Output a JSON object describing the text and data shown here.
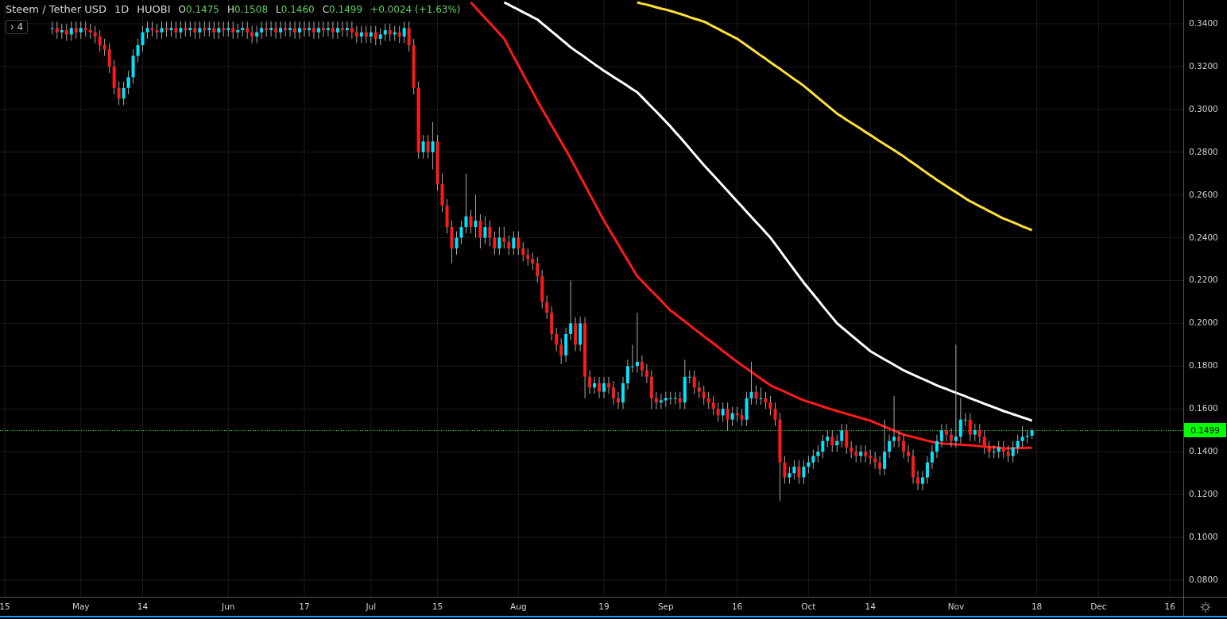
{
  "legend": {
    "interval": "1D",
    "exchange": "HUOBI",
    "ohlc": [
      {
        "label": "O",
        "value": "0.1475"
      },
      {
        "label": "H",
        "value": "0.1508"
      },
      {
        "label": "L",
        "value": "0.1460"
      },
      {
        "label": "C",
        "value": "0.1499"
      }
    ],
    "change": "+0.0024 (+1.63%)",
    "indicators_toggle": {
      "icon_text": "›",
      "count": "4"
    }
  },
  "last_price": "0.1499",
  "chart_data": {
    "type": "candlestick",
    "title": "Steem / Tether USD",
    "grid": true,
    "xlim": [
      "--04-14",
      "--12-28"
    ],
    "ylim": [
      0.0722,
      0.3511
    ],
    "ref_lines": [
      {
        "axis": "y",
        "value": 0.1499,
        "color": "#00ff00"
      }
    ],
    "yticks": [
      {
        "value": 0.08,
        "label": "0.0800"
      },
      {
        "value": 0.1,
        "label": "0.1000"
      },
      {
        "value": 0.12,
        "label": "0.1200"
      },
      {
        "value": 0.14,
        "label": "0.1400"
      },
      {
        "value": 0.16,
        "label": "0.1600"
      },
      {
        "value": 0.18,
        "label": "0.1800"
      },
      {
        "value": 0.2,
        "label": "0.2000"
      },
      {
        "value": 0.22,
        "label": "0.2200"
      },
      {
        "value": 0.24,
        "label": "0.2400"
      },
      {
        "value": 0.26,
        "label": "0.2600"
      },
      {
        "value": 0.28,
        "label": "0.2800"
      },
      {
        "value": 0.3,
        "label": "0.3000"
      },
      {
        "value": 0.32,
        "label": "0.3200"
      },
      {
        "value": 0.34,
        "label": "0.3400"
      }
    ],
    "xticks": [
      {
        "value": "--04-15",
        "label": "15"
      },
      {
        "value": "--05-01",
        "label": "May"
      },
      {
        "value": "--05-14",
        "label": "14"
      },
      {
        "value": "--06-01",
        "label": "Jun"
      },
      {
        "value": "--06-17",
        "label": "17"
      },
      {
        "value": "--07-01",
        "label": "Jul"
      },
      {
        "value": "--07-15",
        "label": "15"
      },
      {
        "value": "--08-01",
        "label": "Aug"
      },
      {
        "value": "--08-19",
        "label": "19"
      },
      {
        "value": "--09-01",
        "label": "Sep"
      },
      {
        "value": "--09-16",
        "label": "16"
      },
      {
        "value": "--10-01",
        "label": "Oct"
      },
      {
        "value": "--10-14",
        "label": "14"
      },
      {
        "value": "--11-01",
        "label": "Nov"
      },
      {
        "value": "--11-18",
        "label": "18"
      },
      {
        "value": "--12-01",
        "label": "Dec"
      },
      {
        "value": "--12-16",
        "label": "16"
      }
    ],
    "x": [
      "--04-25",
      "--04-26",
      "--04-27",
      "--04-28",
      "--04-29",
      "--04-30",
      "--05-01",
      "--05-02",
      "--05-03",
      "--05-04",
      "--05-05",
      "--05-06",
      "--05-07",
      "--05-08",
      "--05-09",
      "--05-10",
      "--05-11",
      "--05-12",
      "--05-13",
      "--05-14",
      "--05-15",
      "--05-16",
      "--05-17",
      "--05-18",
      "--05-19",
      "--05-20",
      "--05-21",
      "--05-22",
      "--05-23",
      "--05-24",
      "--05-25",
      "--05-26",
      "--05-27",
      "--05-28",
      "--05-29",
      "--05-30",
      "--05-31",
      "--06-01",
      "--06-02",
      "--06-03",
      "--06-04",
      "--06-05",
      "--06-06",
      "--06-07",
      "--06-08",
      "--06-09",
      "--06-10",
      "--06-11",
      "--06-12",
      "--06-13",
      "--06-14",
      "--06-15",
      "--06-16",
      "--06-17",
      "--06-18",
      "--06-19",
      "--06-20",
      "--06-21",
      "--06-22",
      "--06-23",
      "--06-24",
      "--06-25",
      "--06-26",
      "--06-27",
      "--06-28",
      "--06-29",
      "--06-30",
      "--07-01",
      "--07-02",
      "--07-03",
      "--07-04",
      "--07-05",
      "--07-06",
      "--07-07",
      "--07-08",
      "--07-09",
      "--07-10",
      "--07-11",
      "--07-12",
      "--07-13",
      "--07-14",
      "--07-15",
      "--07-16",
      "--07-17",
      "--07-18",
      "--07-19",
      "--07-20",
      "--07-21",
      "--07-22",
      "--07-23",
      "--07-24",
      "--07-25",
      "--07-26",
      "--07-27",
      "--07-28",
      "--07-29",
      "--07-30",
      "--07-31",
      "--08-01",
      "--08-02",
      "--08-03",
      "--08-04",
      "--08-05",
      "--08-06",
      "--08-07",
      "--08-08",
      "--08-09",
      "--08-10",
      "--08-11",
      "--08-12",
      "--08-13",
      "--08-14",
      "--08-15",
      "--08-16",
      "--08-17",
      "--08-18",
      "--08-19",
      "--08-20",
      "--08-21",
      "--08-22",
      "--08-23",
      "--08-24",
      "--08-25",
      "--08-26",
      "--08-27",
      "--08-28",
      "--08-29",
      "--08-30",
      "--08-31",
      "--09-01",
      "--09-02",
      "--09-03",
      "--09-04",
      "--09-05",
      "--09-06",
      "--09-07",
      "--09-08",
      "--09-09",
      "--09-10",
      "--09-11",
      "--09-12",
      "--09-13",
      "--09-14",
      "--09-15",
      "--09-16",
      "--09-17",
      "--09-18",
      "--09-19",
      "--09-20",
      "--09-21",
      "--09-22",
      "--09-23",
      "--09-24",
      "--09-25",
      "--09-26",
      "--09-27",
      "--09-28",
      "--09-29",
      "--09-30",
      "--10-01",
      "--10-02",
      "--10-03",
      "--10-04",
      "--10-05",
      "--10-06",
      "--10-07",
      "--10-08",
      "--10-09",
      "--10-10",
      "--10-11",
      "--10-12",
      "--10-13",
      "--10-14",
      "--10-15",
      "--10-16",
      "--10-17",
      "--10-18",
      "--10-19",
      "--10-20",
      "--10-21",
      "--10-22",
      "--10-23",
      "--10-24",
      "--10-25",
      "--10-26",
      "--10-27",
      "--10-28",
      "--10-29",
      "--10-30",
      "--10-31",
      "--11-01",
      "--11-02",
      "--11-03",
      "--11-04",
      "--11-05",
      "--11-06",
      "--11-07",
      "--11-08",
      "--11-09",
      "--11-10",
      "--11-11",
      "--11-12",
      "--11-13",
      "--11-14",
      "--11-15",
      "--11-16",
      "--11-17"
    ],
    "ohlc": [
      [
        0.338,
        0.341,
        0.335,
        0.338
      ],
      [
        0.338,
        0.341,
        0.333,
        0.336
      ],
      [
        0.336,
        0.34,
        0.333,
        0.337
      ],
      [
        0.337,
        0.34,
        0.332,
        0.335
      ],
      [
        0.335,
        0.341,
        0.332,
        0.338
      ],
      [
        0.338,
        0.341,
        0.333,
        0.336
      ],
      [
        0.336,
        0.341,
        0.333,
        0.338
      ],
      [
        0.338,
        0.341,
        0.334,
        0.337
      ],
      [
        0.337,
        0.34,
        0.333,
        0.336
      ],
      [
        0.336,
        0.339,
        0.331,
        0.334
      ],
      [
        0.334,
        0.337,
        0.327,
        0.33
      ],
      [
        0.33,
        0.333,
        0.325,
        0.328
      ],
      [
        0.328,
        0.331,
        0.317,
        0.32
      ],
      [
        0.32,
        0.323,
        0.307,
        0.31
      ],
      [
        0.31,
        0.313,
        0.302,
        0.305
      ],
      [
        0.305,
        0.313,
        0.302,
        0.31
      ],
      [
        0.31,
        0.318,
        0.307,
        0.315
      ],
      [
        0.315,
        0.328,
        0.312,
        0.325
      ],
      [
        0.325,
        0.333,
        0.322,
        0.33
      ],
      [
        0.33,
        0.339,
        0.327,
        0.336
      ],
      [
        0.336,
        0.341,
        0.333,
        0.338
      ],
      [
        0.338,
        0.341,
        0.334,
        0.337
      ],
      [
        0.337,
        0.34,
        0.333,
        0.336
      ],
      [
        0.336,
        0.341,
        0.333,
        0.338
      ],
      [
        0.338,
        0.341,
        0.334,
        0.337
      ],
      [
        0.337,
        0.341,
        0.334,
        0.338
      ],
      [
        0.338,
        0.341,
        0.333,
        0.336
      ],
      [
        0.336,
        0.341,
        0.333,
        0.338
      ],
      [
        0.338,
        0.341,
        0.334,
        0.337
      ],
      [
        0.337,
        0.341,
        0.334,
        0.338
      ],
      [
        0.338,
        0.341,
        0.333,
        0.336
      ],
      [
        0.336,
        0.341,
        0.333,
        0.338
      ],
      [
        0.338,
        0.341,
        0.334,
        0.337
      ],
      [
        0.337,
        0.341,
        0.334,
        0.338
      ],
      [
        0.338,
        0.341,
        0.333,
        0.336
      ],
      [
        0.336,
        0.341,
        0.333,
        0.338
      ],
      [
        0.338,
        0.341,
        0.334,
        0.337
      ],
      [
        0.337,
        0.341,
        0.334,
        0.338
      ],
      [
        0.338,
        0.341,
        0.333,
        0.336
      ],
      [
        0.336,
        0.34,
        0.333,
        0.337
      ],
      [
        0.337,
        0.341,
        0.334,
        0.338
      ],
      [
        0.338,
        0.341,
        0.333,
        0.336
      ],
      [
        0.336,
        0.339,
        0.331,
        0.334
      ],
      [
        0.334,
        0.339,
        0.331,
        0.336
      ],
      [
        0.336,
        0.341,
        0.333,
        0.338
      ],
      [
        0.338,
        0.341,
        0.334,
        0.337
      ],
      [
        0.337,
        0.341,
        0.334,
        0.338
      ],
      [
        0.338,
        0.341,
        0.333,
        0.336
      ],
      [
        0.336,
        0.341,
        0.333,
        0.338
      ],
      [
        0.338,
        0.341,
        0.334,
        0.337
      ],
      [
        0.337,
        0.341,
        0.334,
        0.338
      ],
      [
        0.338,
        0.341,
        0.333,
        0.336
      ],
      [
        0.336,
        0.341,
        0.333,
        0.338
      ],
      [
        0.338,
        0.341,
        0.334,
        0.337
      ],
      [
        0.337,
        0.341,
        0.334,
        0.338
      ],
      [
        0.338,
        0.341,
        0.333,
        0.336
      ],
      [
        0.336,
        0.341,
        0.333,
        0.338
      ],
      [
        0.338,
        0.341,
        0.334,
        0.337
      ],
      [
        0.337,
        0.341,
        0.334,
        0.338
      ],
      [
        0.338,
        0.341,
        0.333,
        0.336
      ],
      [
        0.336,
        0.341,
        0.333,
        0.338
      ],
      [
        0.338,
        0.341,
        0.334,
        0.337
      ],
      [
        0.337,
        0.341,
        0.334,
        0.338
      ],
      [
        0.338,
        0.341,
        0.333,
        0.336
      ],
      [
        0.336,
        0.339,
        0.331,
        0.334
      ],
      [
        0.334,
        0.339,
        0.331,
        0.336
      ],
      [
        0.336,
        0.339,
        0.331,
        0.334
      ],
      [
        0.334,
        0.339,
        0.331,
        0.336
      ],
      [
        0.336,
        0.339,
        0.33,
        0.333
      ],
      [
        0.333,
        0.338,
        0.33,
        0.335
      ],
      [
        0.335,
        0.34,
        0.332,
        0.337
      ],
      [
        0.337,
        0.34,
        0.332,
        0.335
      ],
      [
        0.335,
        0.339,
        0.332,
        0.336
      ],
      [
        0.336,
        0.339,
        0.331,
        0.334
      ],
      [
        0.334,
        0.341,
        0.331,
        0.338
      ],
      [
        0.338,
        0.341,
        0.327,
        0.33
      ],
      [
        0.33,
        0.333,
        0.307,
        0.31
      ],
      [
        0.31,
        0.313,
        0.277,
        0.28
      ],
      [
        0.28,
        0.288,
        0.277,
        0.285
      ],
      [
        0.285,
        0.288,
        0.277,
        0.28
      ],
      [
        0.28,
        0.294,
        0.272,
        0.285
      ],
      [
        0.285,
        0.288,
        0.262,
        0.265
      ],
      [
        0.265,
        0.27,
        0.252,
        0.255
      ],
      [
        0.255,
        0.258,
        0.242,
        0.245
      ],
      [
        0.245,
        0.248,
        0.228,
        0.235
      ],
      [
        0.235,
        0.243,
        0.232,
        0.24
      ],
      [
        0.24,
        0.248,
        0.237,
        0.245
      ],
      [
        0.245,
        0.27,
        0.242,
        0.25
      ],
      [
        0.25,
        0.253,
        0.242,
        0.245
      ],
      [
        0.245,
        0.26,
        0.24,
        0.248
      ],
      [
        0.248,
        0.251,
        0.235,
        0.24
      ],
      [
        0.24,
        0.25,
        0.237,
        0.245
      ],
      [
        0.245,
        0.248,
        0.236,
        0.24
      ],
      [
        0.24,
        0.243,
        0.232,
        0.235
      ],
      [
        0.235,
        0.245,
        0.232,
        0.24
      ],
      [
        0.24,
        0.245,
        0.235,
        0.238
      ],
      [
        0.238,
        0.241,
        0.232,
        0.235
      ],
      [
        0.235,
        0.243,
        0.232,
        0.24
      ],
      [
        0.24,
        0.243,
        0.232,
        0.235
      ],
      [
        0.235,
        0.238,
        0.229,
        0.232
      ],
      [
        0.232,
        0.235,
        0.227,
        0.23
      ],
      [
        0.23,
        0.233,
        0.225,
        0.228
      ],
      [
        0.228,
        0.231,
        0.219,
        0.222
      ],
      [
        0.222,
        0.225,
        0.207,
        0.21
      ],
      [
        0.21,
        0.213,
        0.202,
        0.205
      ],
      [
        0.205,
        0.208,
        0.192,
        0.195
      ],
      [
        0.195,
        0.198,
        0.187,
        0.19
      ],
      [
        0.19,
        0.193,
        0.181,
        0.185
      ],
      [
        0.185,
        0.198,
        0.182,
        0.195
      ],
      [
        0.195,
        0.22,
        0.192,
        0.2
      ],
      [
        0.2,
        0.203,
        0.187,
        0.19
      ],
      [
        0.19,
        0.203,
        0.187,
        0.2
      ],
      [
        0.2,
        0.203,
        0.165,
        0.175
      ],
      [
        0.175,
        0.178,
        0.167,
        0.17
      ],
      [
        0.17,
        0.175,
        0.167,
        0.172
      ],
      [
        0.172,
        0.175,
        0.165,
        0.168
      ],
      [
        0.168,
        0.175,
        0.165,
        0.172
      ],
      [
        0.172,
        0.175,
        0.167,
        0.17
      ],
      [
        0.17,
        0.173,
        0.162,
        0.165
      ],
      [
        0.165,
        0.168,
        0.16,
        0.163
      ],
      [
        0.163,
        0.175,
        0.16,
        0.172
      ],
      [
        0.172,
        0.183,
        0.169,
        0.18
      ],
      [
        0.18,
        0.19,
        0.177,
        0.18
      ],
      [
        0.18,
        0.205,
        0.177,
        0.182
      ],
      [
        0.182,
        0.185,
        0.175,
        0.178
      ],
      [
        0.178,
        0.181,
        0.172,
        0.175
      ],
      [
        0.175,
        0.178,
        0.16,
        0.165
      ],
      [
        0.165,
        0.168,
        0.16,
        0.163
      ],
      [
        0.163,
        0.167,
        0.16,
        0.164
      ],
      [
        0.164,
        0.168,
        0.161,
        0.165
      ],
      [
        0.165,
        0.168,
        0.162,
        0.165
      ],
      [
        0.165,
        0.168,
        0.162,
        0.165
      ],
      [
        0.165,
        0.168,
        0.16,
        0.163
      ],
      [
        0.163,
        0.183,
        0.16,
        0.175
      ],
      [
        0.175,
        0.178,
        0.172,
        0.175
      ],
      [
        0.175,
        0.178,
        0.167,
        0.17
      ],
      [
        0.17,
        0.173,
        0.165,
        0.168
      ],
      [
        0.168,
        0.171,
        0.162,
        0.165
      ],
      [
        0.165,
        0.168,
        0.16,
        0.163
      ],
      [
        0.163,
        0.166,
        0.157,
        0.16
      ],
      [
        0.16,
        0.163,
        0.154,
        0.157
      ],
      [
        0.157,
        0.163,
        0.154,
        0.16
      ],
      [
        0.16,
        0.163,
        0.15,
        0.155
      ],
      [
        0.155,
        0.161,
        0.152,
        0.158
      ],
      [
        0.158,
        0.161,
        0.154,
        0.157
      ],
      [
        0.157,
        0.16,
        0.152,
        0.155
      ],
      [
        0.155,
        0.168,
        0.152,
        0.165
      ],
      [
        0.165,
        0.182,
        0.162,
        0.168
      ],
      [
        0.168,
        0.171,
        0.162,
        0.165
      ],
      [
        0.165,
        0.17,
        0.162,
        0.165
      ],
      [
        0.165,
        0.168,
        0.16,
        0.163
      ],
      [
        0.163,
        0.166,
        0.157,
        0.16
      ],
      [
        0.16,
        0.163,
        0.152,
        0.155
      ],
      [
        0.155,
        0.158,
        0.117,
        0.135
      ],
      [
        0.135,
        0.138,
        0.125,
        0.128
      ],
      [
        0.128,
        0.133,
        0.125,
        0.13
      ],
      [
        0.13,
        0.136,
        0.127,
        0.133
      ],
      [
        0.133,
        0.136,
        0.125,
        0.128
      ],
      [
        0.128,
        0.136,
        0.125,
        0.133
      ],
      [
        0.133,
        0.138,
        0.13,
        0.135
      ],
      [
        0.135,
        0.141,
        0.132,
        0.138
      ],
      [
        0.138,
        0.143,
        0.135,
        0.14
      ],
      [
        0.14,
        0.148,
        0.137,
        0.145
      ],
      [
        0.145,
        0.15,
        0.142,
        0.147
      ],
      [
        0.147,
        0.15,
        0.14,
        0.143
      ],
      [
        0.143,
        0.148,
        0.14,
        0.145
      ],
      [
        0.145,
        0.153,
        0.142,
        0.15
      ],
      [
        0.15,
        0.153,
        0.139,
        0.142
      ],
      [
        0.142,
        0.145,
        0.137,
        0.14
      ],
      [
        0.14,
        0.143,
        0.135,
        0.138
      ],
      [
        0.138,
        0.143,
        0.135,
        0.14
      ],
      [
        0.14,
        0.143,
        0.135,
        0.138
      ],
      [
        0.138,
        0.141,
        0.134,
        0.137
      ],
      [
        0.137,
        0.14,
        0.132,
        0.135
      ],
      [
        0.135,
        0.138,
        0.129,
        0.132
      ],
      [
        0.132,
        0.155,
        0.129,
        0.14
      ],
      [
        0.14,
        0.148,
        0.137,
        0.145
      ],
      [
        0.145,
        0.166,
        0.142,
        0.147
      ],
      [
        0.147,
        0.15,
        0.142,
        0.145
      ],
      [
        0.145,
        0.148,
        0.137,
        0.14
      ],
      [
        0.14,
        0.143,
        0.135,
        0.138
      ],
      [
        0.138,
        0.141,
        0.125,
        0.128
      ],
      [
        0.128,
        0.131,
        0.122,
        0.125
      ],
      [
        0.125,
        0.131,
        0.122,
        0.128
      ],
      [
        0.128,
        0.138,
        0.125,
        0.135
      ],
      [
        0.135,
        0.143,
        0.132,
        0.14
      ],
      [
        0.14,
        0.148,
        0.137,
        0.145
      ],
      [
        0.145,
        0.153,
        0.142,
        0.15
      ],
      [
        0.15,
        0.153,
        0.145,
        0.148
      ],
      [
        0.148,
        0.151,
        0.142,
        0.145
      ],
      [
        0.145,
        0.19,
        0.142,
        0.147
      ],
      [
        0.147,
        0.165,
        0.144,
        0.155
      ],
      [
        0.155,
        0.158,
        0.152,
        0.155
      ],
      [
        0.155,
        0.158,
        0.145,
        0.148
      ],
      [
        0.148,
        0.153,
        0.145,
        0.15
      ],
      [
        0.15,
        0.153,
        0.144,
        0.147
      ],
      [
        0.147,
        0.15,
        0.139,
        0.142
      ],
      [
        0.142,
        0.145,
        0.137,
        0.14
      ],
      [
        0.14,
        0.143,
        0.137,
        0.14
      ],
      [
        0.14,
        0.145,
        0.137,
        0.142
      ],
      [
        0.142,
        0.145,
        0.137,
        0.14
      ],
      [
        0.14,
        0.143,
        0.135,
        0.138
      ],
      [
        0.138,
        0.145,
        0.135,
        0.142
      ],
      [
        0.142,
        0.148,
        0.139,
        0.145
      ],
      [
        0.145,
        0.152,
        0.142,
        0.147
      ],
      [
        0.147,
        0.15,
        0.144,
        0.1475
      ],
      [
        0.1475,
        0.1508,
        0.146,
        0.1499
      ]
    ],
    "series": [
      {
        "type": "line",
        "color": "#ff1a1a",
        "values": [
          null,
          null,
          null,
          null,
          null,
          null,
          null,
          null,
          null,
          null,
          null,
          null,
          null,
          null,
          null,
          null,
          null,
          null,
          null,
          null,
          null,
          null,
          null,
          null,
          null,
          null,
          null,
          null,
          null,
          null,
          null,
          null,
          null,
          null,
          null,
          null,
          null,
          null,
          null,
          null,
          null,
          null,
          null,
          null,
          null,
          null,
          null,
          null,
          null,
          null,
          null,
          null,
          null,
          null,
          null,
          null,
          null,
          null,
          null,
          null,
          null,
          null,
          null,
          null,
          null,
          null,
          null,
          null,
          null,
          null,
          null,
          null,
          null,
          null,
          null,
          null,
          null,
          null,
          null,
          null,
          null,
          null,
          null,
          null,
          null,
          null,
          null,
          null,
          0.35,
          0.3476,
          0.3451,
          0.3427,
          0.3403,
          0.3379,
          0.3354,
          0.333,
          0.3289,
          0.3247,
          0.3206,
          0.3164,
          0.3123,
          0.3081,
          0.304,
          0.3001,
          0.2963,
          0.2924,
          0.2886,
          0.2847,
          0.2809,
          0.277,
          0.2729,
          0.2687,
          0.2646,
          0.2604,
          0.2563,
          0.2521,
          0.248,
          0.2443,
          0.2406,
          0.2369,
          0.2331,
          0.2294,
          0.2257,
          0.222,
          0.2197,
          0.2174,
          0.2151,
          0.2129,
          0.2106,
          0.2083,
          0.206,
          0.2043,
          0.2026,
          0.2009,
          0.1991,
          0.1974,
          0.1957,
          0.194,
          0.1923,
          0.1906,
          0.1889,
          0.1871,
          0.1854,
          0.1837,
          0.182,
          0.1804,
          0.1789,
          0.1773,
          0.1757,
          0.1741,
          0.1726,
          0.171,
          0.17,
          0.169,
          0.168,
          0.167,
          0.166,
          0.165,
          0.164,
          0.1633,
          0.1626,
          0.1619,
          0.1611,
          0.1604,
          0.1597,
          0.159,
          0.1584,
          0.1577,
          0.1571,
          0.1564,
          0.1558,
          0.1551,
          0.1545,
          0.1536,
          0.1526,
          0.1517,
          0.1508,
          0.1499,
          0.1489,
          0.148,
          0.1474,
          0.1469,
          0.1463,
          0.1457,
          0.1451,
          0.1446,
          0.144,
          0.1439,
          0.1437,
          0.1436,
          0.1434,
          0.1433,
          0.1431,
          0.143,
          0.1428,
          0.1426,
          0.1424,
          0.1422,
          0.1421,
          0.1419,
          0.1415,
          0.1416,
          0.1416,
          0.1417,
          0.1417,
          0.1418,
          0.1418
        ]
      },
      {
        "type": "line",
        "color": "#ffffff",
        "values": [
          null,
          null,
          null,
          null,
          null,
          null,
          null,
          null,
          null,
          null,
          null,
          null,
          null,
          null,
          null,
          null,
          null,
          null,
          null,
          null,
          null,
          null,
          null,
          null,
          null,
          null,
          null,
          null,
          null,
          null,
          null,
          null,
          null,
          null,
          null,
          null,
          null,
          null,
          null,
          null,
          null,
          null,
          null,
          null,
          null,
          null,
          null,
          null,
          null,
          null,
          null,
          null,
          null,
          null,
          null,
          null,
          null,
          null,
          null,
          null,
          null,
          null,
          null,
          null,
          null,
          null,
          null,
          null,
          null,
          null,
          null,
          null,
          null,
          null,
          null,
          null,
          null,
          null,
          null,
          null,
          null,
          null,
          null,
          null,
          null,
          null,
          null,
          null,
          null,
          null,
          null,
          null,
          null,
          null,
          null,
          0.35,
          0.3489,
          0.3477,
          0.3466,
          0.3454,
          0.3443,
          0.3431,
          0.342,
          0.3401,
          0.3383,
          0.3364,
          0.3346,
          0.3327,
          0.3309,
          0.329,
          0.3274,
          0.3259,
          0.3243,
          0.3227,
          0.3211,
          0.3196,
          0.318,
          0.3166,
          0.3151,
          0.3137,
          0.3123,
          0.3109,
          0.3094,
          0.308,
          0.3057,
          0.3034,
          0.3011,
          0.2989,
          0.2966,
          0.2943,
          0.292,
          0.2894,
          0.2869,
          0.2843,
          0.2817,
          0.2791,
          0.2766,
          0.274,
          0.2716,
          0.2691,
          0.2667,
          0.2643,
          0.2619,
          0.2594,
          0.257,
          0.2546,
          0.2521,
          0.2497,
          0.2473,
          0.2449,
          0.2424,
          0.24,
          0.237,
          0.234,
          0.231,
          0.228,
          0.225,
          0.222,
          0.219,
          0.2163,
          0.2136,
          0.2109,
          0.2081,
          0.2054,
          0.2027,
          0.2,
          0.1981,
          0.1963,
          0.1944,
          0.1926,
          0.1907,
          0.1889,
          0.187,
          0.1857,
          0.1844,
          0.1831,
          0.1819,
          0.1806,
          0.1793,
          0.178,
          0.177,
          0.176,
          0.175,
          0.174,
          0.173,
          0.172,
          0.171,
          0.1701,
          0.1693,
          0.1684,
          0.1676,
          0.1667,
          0.1659,
          0.165,
          0.1641,
          0.1633,
          0.1624,
          0.1616,
          0.1607,
          0.1599,
          0.159,
          0.1583,
          0.1575,
          0.1568,
          0.156,
          0.1553,
          0.1545
        ]
      },
      {
        "type": "line",
        "color": "#ffe033",
        "values": [
          null,
          null,
          null,
          null,
          null,
          null,
          null,
          null,
          null,
          null,
          null,
          null,
          null,
          null,
          null,
          null,
          null,
          null,
          null,
          null,
          null,
          null,
          null,
          null,
          null,
          null,
          null,
          null,
          null,
          null,
          null,
          null,
          null,
          null,
          null,
          null,
          null,
          null,
          null,
          null,
          null,
          null,
          null,
          null,
          null,
          null,
          null,
          null,
          null,
          null,
          null,
          null,
          null,
          null,
          null,
          null,
          null,
          null,
          null,
          null,
          null,
          null,
          null,
          null,
          null,
          null,
          null,
          null,
          null,
          null,
          null,
          null,
          null,
          null,
          null,
          null,
          null,
          null,
          null,
          null,
          null,
          null,
          null,
          null,
          null,
          null,
          null,
          null,
          null,
          null,
          null,
          null,
          null,
          null,
          null,
          null,
          null,
          null,
          null,
          null,
          null,
          null,
          null,
          null,
          null,
          null,
          null,
          null,
          null,
          null,
          null,
          null,
          null,
          null,
          null,
          null,
          null,
          null,
          null,
          null,
          null,
          null,
          null,
          0.35,
          0.3494,
          0.3489,
          0.3483,
          0.3477,
          0.3471,
          0.3466,
          0.346,
          0.3453,
          0.3446,
          0.3439,
          0.3431,
          0.3424,
          0.3417,
          0.341,
          0.3399,
          0.3387,
          0.3376,
          0.3364,
          0.3353,
          0.3341,
          0.333,
          0.3314,
          0.3299,
          0.3283,
          0.3267,
          0.3251,
          0.3236,
          0.322,
          0.3204,
          0.3189,
          0.3173,
          0.3157,
          0.3141,
          0.3126,
          0.311,
          0.3091,
          0.3073,
          0.3054,
          0.3036,
          0.3017,
          0.2999,
          0.298,
          0.2966,
          0.2951,
          0.2937,
          0.2923,
          0.2909,
          0.2894,
          0.288,
          0.2866,
          0.2851,
          0.2837,
          0.2823,
          0.2809,
          0.2794,
          0.278,
          0.2764,
          0.2749,
          0.2733,
          0.2717,
          0.2701,
          0.2686,
          0.267,
          0.2656,
          0.2641,
          0.2627,
          0.2613,
          0.2599,
          0.2584,
          0.257,
          0.2559,
          0.2547,
          0.2536,
          0.2524,
          0.2513,
          0.2501,
          0.249,
          0.2481,
          0.2472,
          0.2463,
          0.2453,
          0.2444,
          0.2435
        ]
      }
    ]
  }
}
